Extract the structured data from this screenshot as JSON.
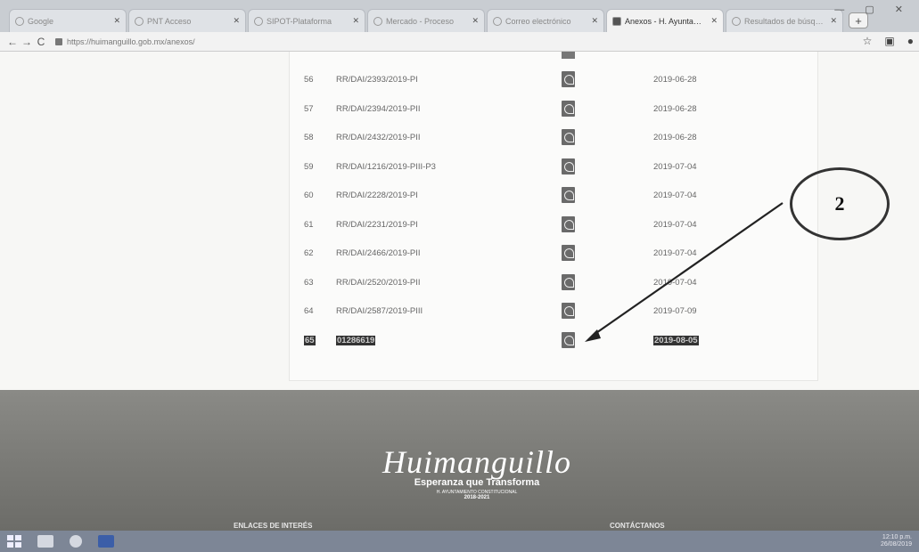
{
  "browser": {
    "tabs": [
      {
        "label": "Google",
        "active": false
      },
      {
        "label": "PNT Acceso",
        "active": false
      },
      {
        "label": "SIPOT-Plataforma",
        "active": false
      },
      {
        "label": "Mercado - Proceso",
        "active": false
      },
      {
        "label": "Correo electrónico",
        "active": false
      },
      {
        "label": "Anexos - H. Ayuntamiento",
        "active": true
      },
      {
        "label": "Resultados de búsqueda",
        "active": false
      }
    ],
    "url": "https://huimanguillo.gob.mx/anexos/",
    "window_controls": "— ▢ ✕"
  },
  "table": {
    "rows": [
      {
        "num": "56",
        "file": "RR/DAI/2393/2019-PI",
        "date": "2019-06-28",
        "highlight": false
      },
      {
        "num": "57",
        "file": "RR/DAI/2394/2019-PII",
        "date": "2019-06-28",
        "highlight": false
      },
      {
        "num": "58",
        "file": "RR/DAI/2432/2019-PII",
        "date": "2019-06-28",
        "highlight": false
      },
      {
        "num": "59",
        "file": "RR/DAI/1216/2019-PIII-P3",
        "date": "2019-07-04",
        "highlight": false
      },
      {
        "num": "60",
        "file": "RR/DAI/2228/2019-PI",
        "date": "2019-07-04",
        "highlight": false
      },
      {
        "num": "61",
        "file": "RR/DAI/2231/2019-PI",
        "date": "2019-07-04",
        "highlight": false
      },
      {
        "num": "62",
        "file": "RR/DAI/2466/2019-PII",
        "date": "2019-07-04",
        "highlight": false
      },
      {
        "num": "63",
        "file": "RR/DAI/2520/2019-PII",
        "date": "2019-07-04",
        "highlight": false
      },
      {
        "num": "64",
        "file": "RR/DAI/2587/2019-PIII",
        "date": "2019-07-09",
        "highlight": false
      },
      {
        "num": "65",
        "file": "01286619",
        "date": "2019-08-05",
        "highlight": true
      }
    ]
  },
  "annotation": {
    "label": "2"
  },
  "footer": {
    "brand": "Huimanguillo",
    "slogan": "Esperanza que Transforma",
    "subtitle": "H. AYUNTAMIENTO CONSTITUCIONAL",
    "years": "2018-2021",
    "links_heading": "ENLACES DE INTERÉS",
    "contact_heading": "CONTÁCTANOS"
  },
  "taskbar": {
    "clock": "12:10 p.m.",
    "date": "26/08/2019"
  }
}
